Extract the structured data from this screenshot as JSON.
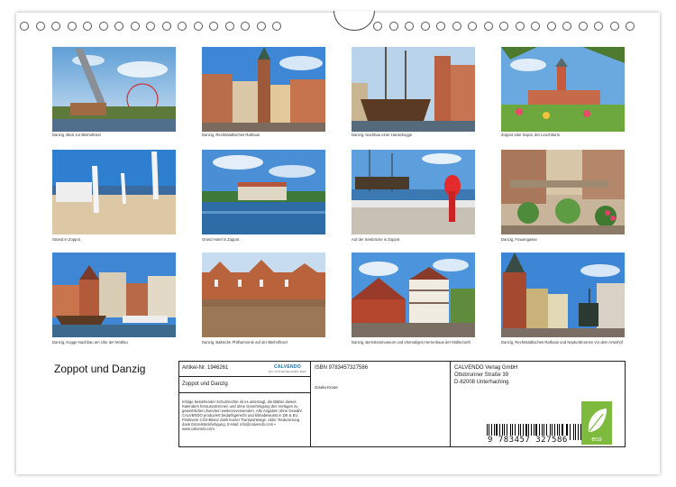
{
  "photos": [
    {
      "caption": "Danzig, Blick zur Bleihofinsel"
    },
    {
      "caption": "Danzig, Rechtstädtisches Rathaus"
    },
    {
      "caption": "Danzig, Nachbau einer Hansekogge"
    },
    {
      "caption": "Zoppot oder Sopot, der Leuchtturm"
    },
    {
      "caption": "Strand in Zoppot"
    },
    {
      "caption": "Grand Hotel in Zoppot"
    },
    {
      "caption": "Auf der Seebrücke in Zoppot"
    },
    {
      "caption": "Danzig, Frauengasse"
    },
    {
      "caption": "Danzig, Kogge-Nachbau am Ufer der Mottlau"
    },
    {
      "caption": "Danzig, Baltische Philharmonie auf der Bleihofinsel"
    },
    {
      "caption": "Danzig, Bernsteinmuseum und ehemaliges Herrenhaus der Müllerzunft"
    },
    {
      "caption": "Danzig, Rechtstädtisches Rathaus und Neptunbrunnen vor dem Artushof"
    }
  ],
  "calendar_title": "Zoppot und Danzig",
  "info": {
    "article_label": "Artikel-Nr. 1946261",
    "title_repeat": "Zoppot und Danzig",
    "legal_text": "Infolge bestehender Schutzrechte ist es untersagt, die Blätter dieses Kalenders herauszutrennen und ohne Genehmigung des Verlages zu gewerblichen Zwecken weiterzuverwenden. Alle Angaben ohne Gewähr. CALVENDO produziert bedarfsgerecht und klimabewusst in DE & EU. Positivere CO2-Bilanz dank kurzer Transportwege. Aktiv: Reduzierung dank Einzelstückfertigung. E-Mail: info@calvendo.com • www.calvendo.com",
    "logo_text": "CALVENDO",
    "logo_sub": "EIN UNTERNEHMEN DER",
    "isbn": "ISBN 9783457327586",
    "author": "Gisela Kruse",
    "publisher_name": "CALVENDO Verlag GmbH",
    "publisher_street": "Ottobrunner Straße 39",
    "publisher_city": "D-82008 Unterhaching",
    "barcode_digits": "9 783457 327586",
    "eco_label": "eco"
  }
}
